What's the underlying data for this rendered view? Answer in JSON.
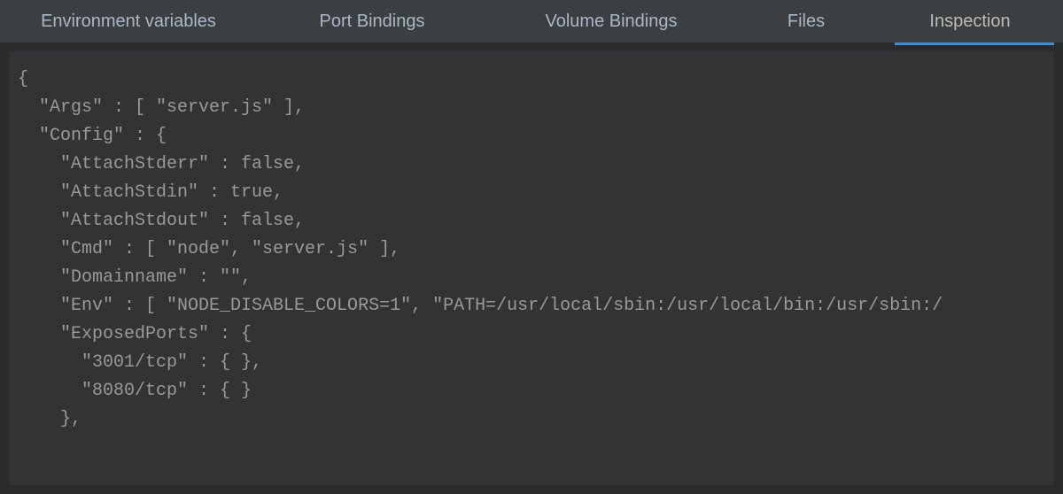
{
  "tabs": [
    {
      "label": "Environment variables",
      "active": false
    },
    {
      "label": "Port Bindings",
      "active": false
    },
    {
      "label": "Volume Bindings",
      "active": false
    },
    {
      "label": "Files",
      "active": false
    },
    {
      "label": "Inspection",
      "active": true
    }
  ],
  "json": {
    "line1": "{",
    "line2": "  \"Args\" : [ \"server.js\" ],",
    "line3": "  \"Config\" : {",
    "line4": "    \"AttachStderr\" : false,",
    "line5": "    \"AttachStdin\" : true,",
    "line6": "    \"AttachStdout\" : false,",
    "line7": "    \"Cmd\" : [ \"node\", \"server.js\" ],",
    "line8": "    \"Domainname\" : \"\",",
    "line9": "    \"Env\" : [ \"NODE_DISABLE_COLORS=1\", \"PATH=/usr/local/sbin:/usr/local/bin:/usr/sbin:/",
    "line10": "    \"ExposedPorts\" : {",
    "line11": "      \"3001/tcp\" : { },",
    "line12": "      \"8080/tcp\" : { }",
    "line13": "    },"
  }
}
